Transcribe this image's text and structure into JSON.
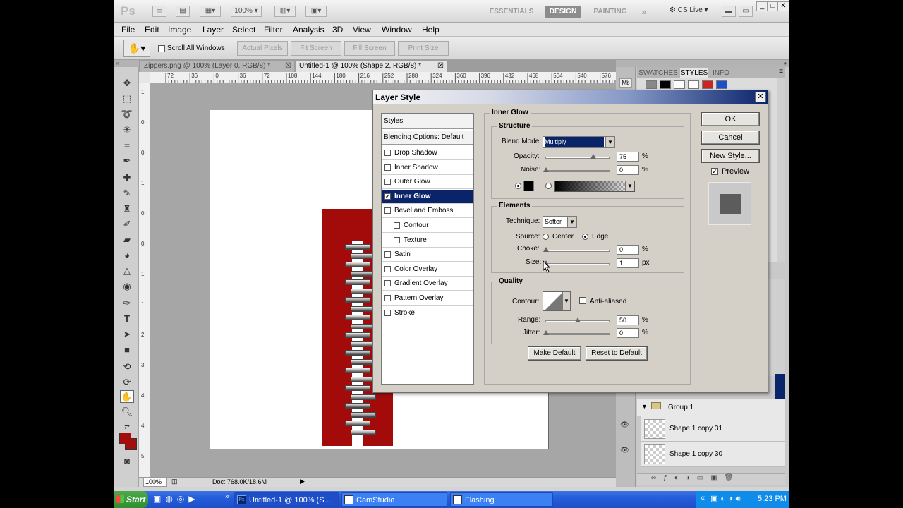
{
  "app": {
    "logo": "Ps",
    "zoom_select": "100%",
    "workspaces": [
      "ESSENTIALS",
      "DESIGN",
      "PAINTING"
    ],
    "more": "»",
    "cs_live": "CS Live"
  },
  "menu": [
    "File",
    "Edit",
    "Image",
    "Layer",
    "Select",
    "Filter",
    "Analysis",
    "3D",
    "View",
    "Window",
    "Help"
  ],
  "options": {
    "scroll_all": "Scroll All Windows",
    "actual_pixels": "Actual Pixels",
    "fit_screen": "Fit Screen",
    "fill_screen": "Fill Screen",
    "print_size": "Print Size"
  },
  "tabs": [
    {
      "label": "Zippers.png @ 100% (Layer 0, RGB/8) *"
    },
    {
      "label": "Untitled-1 @ 100% (Shape 2, RGB/8) *"
    }
  ],
  "ruler_h": [
    "72",
    "36",
    "0",
    "36",
    "72",
    "108",
    "144",
    "180",
    "216",
    "252",
    "288",
    "324",
    "360",
    "396",
    "432",
    "468",
    "504",
    "540",
    "576"
  ],
  "ruler_v": [
    "1",
    "0",
    "0",
    "1",
    "0",
    "0",
    "1",
    "1",
    "2",
    "3",
    "4",
    "4",
    "5"
  ],
  "status": {
    "zoom": "100%",
    "doc": "Doc: 768.0K/18.6M"
  },
  "panels": {
    "tabs": [
      "SWATCHES",
      "STYLES",
      "INFO"
    ],
    "group": "Group 1",
    "layers": [
      "Shape 1 copy 31",
      "Shape 1 copy 30"
    ],
    "style_swatches": [
      "#888888",
      "#000000",
      "#ffffff",
      "#cc2222",
      "#1e4fc8"
    ]
  },
  "dialog": {
    "title": "Layer Style",
    "list": {
      "header": "Styles",
      "blending": "Blending Options: Default",
      "items": [
        {
          "label": "Drop Shadow",
          "checked": false
        },
        {
          "label": "Inner Shadow",
          "checked": false
        },
        {
          "label": "Outer Glow",
          "checked": false
        },
        {
          "label": "Inner Glow",
          "checked": true
        },
        {
          "label": "Bevel and Emboss",
          "checked": false
        },
        {
          "label": "Contour",
          "checked": false
        },
        {
          "label": "Texture",
          "checked": false
        },
        {
          "label": "Satin",
          "checked": false
        },
        {
          "label": "Color Overlay",
          "checked": false
        },
        {
          "label": "Gradient Overlay",
          "checked": false
        },
        {
          "label": "Pattern Overlay",
          "checked": false
        },
        {
          "label": "Stroke",
          "checked": false
        }
      ]
    },
    "section": "Inner Glow",
    "structure": {
      "title": "Structure",
      "blend_mode_label": "Blend Mode:",
      "blend_mode": "Multiply",
      "opacity_label": "Opacity:",
      "opacity": "75",
      "opacity_level": 0.75,
      "noise_label": "Noise:",
      "noise": "0",
      "noise_level": 0,
      "pct": "%"
    },
    "elements": {
      "title": "Elements",
      "technique_label": "Technique:",
      "technique": "Softer",
      "source_label": "Source:",
      "source_center": "Center",
      "source_edge": "Edge",
      "choke_label": "Choke:",
      "choke": "0",
      "choke_level": 0,
      "size_label": "Size:",
      "size": "1",
      "size_level": 0.004,
      "px": "px"
    },
    "quality": {
      "title": "Quality",
      "contour_label": "Contour:",
      "antialiased": "Anti-aliased",
      "range_label": "Range:",
      "range": "50",
      "range_level": 0.5,
      "jitter_label": "Jitter:",
      "jitter": "0",
      "jitter_level": 0
    },
    "make_default": "Make Default",
    "reset_default": "Reset to Default",
    "ok": "OK",
    "cancel": "Cancel",
    "new_style": "New Style...",
    "preview": "Preview"
  },
  "taskbar": {
    "start": "Start",
    "tasks": [
      "Untitled-1 @ 100% (S...",
      "CamStudio",
      "Flashing"
    ],
    "clock": "5:23 PM"
  }
}
